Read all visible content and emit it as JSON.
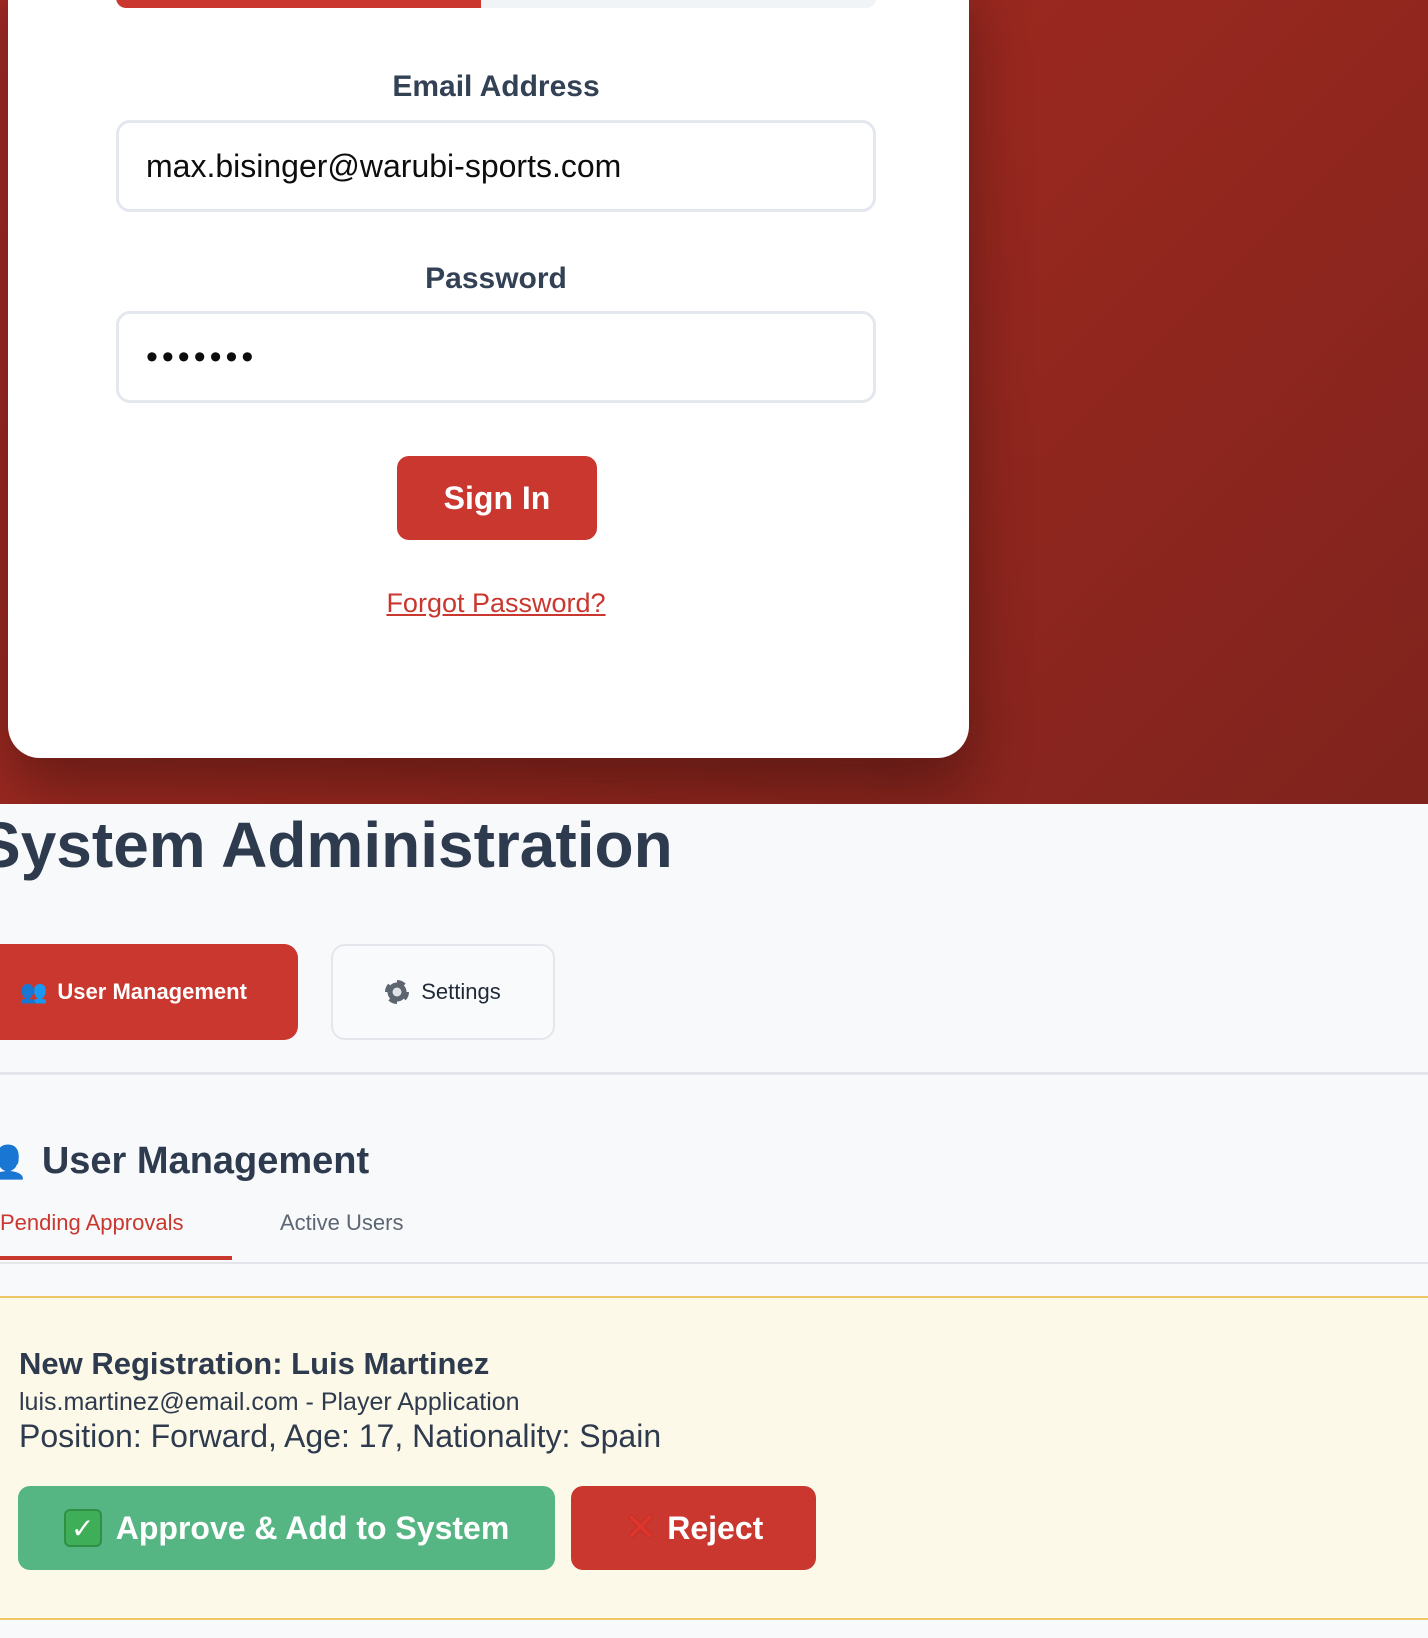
{
  "login": {
    "progress_fraction": 0.48,
    "email_label": "Email Address",
    "email_value": "max.bisinger@warubi-sports.com",
    "password_label": "Password",
    "password_value": "•••••••",
    "signin_label": "Sign In",
    "forgot_label": "Forgot Password?"
  },
  "admin": {
    "page_title": "System Administration",
    "tabs": [
      {
        "label": "User Management",
        "icon": "people-icon",
        "active": true
      },
      {
        "label": "Settings",
        "icon": "gear-icon",
        "active": false
      }
    ]
  },
  "user_management": {
    "title": "User Management",
    "icon": "user-icon",
    "subtabs": [
      {
        "label": "Pending Approvals",
        "active": true
      },
      {
        "label": "Active Users",
        "active": false
      }
    ],
    "pending": {
      "title": "New Registration: Luis Martinez",
      "subtitle": "luis.martinez@email.com - Player Application",
      "details": "Position: Forward, Age: 17, Nationality: Spain",
      "approve_label": "Approve & Add to System",
      "reject_label": "Reject"
    }
  },
  "colors": {
    "brand_red": "#c9372f",
    "approve_green": "#55b684",
    "pending_bg": "#fdf9e9"
  }
}
